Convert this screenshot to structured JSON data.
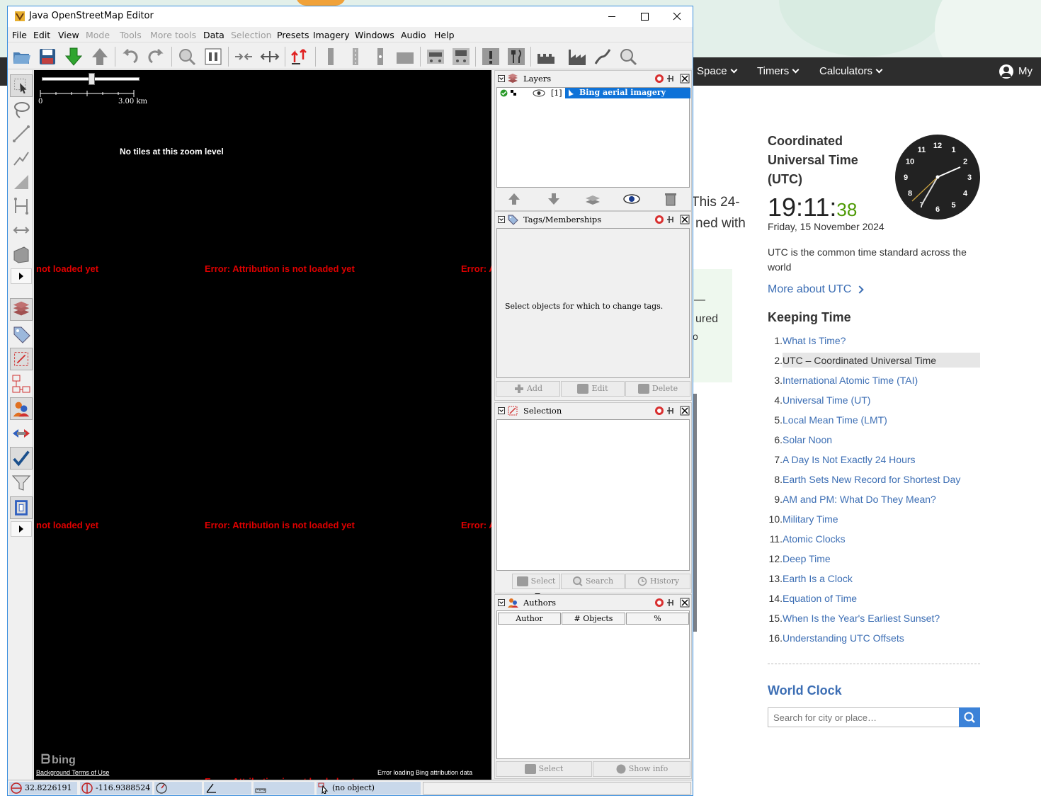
{
  "web": {
    "nav": {
      "space": "Space",
      "timers": "Timers",
      "calculators": "Calculators",
      "account": "My A"
    },
    "fragments": {
      "this24": "This 24-",
      "nedwith": "ned with",
      "ured": "ured",
      "o": "o",
      "dash": "—"
    },
    "utc": {
      "title": "Coordinated Universal Time (UTC)",
      "time_hm": "19:11:",
      "time_s": "38",
      "date": "Friday, 15 November 2024",
      "desc": "UTC is the common time standard across the world",
      "more": "More about UTC",
      "clock_numbers": [
        "12",
        "1",
        "2",
        "3",
        "4",
        "5",
        "6",
        "7",
        "8",
        "9",
        "10",
        "11"
      ]
    },
    "keeping_time": {
      "title": "Keeping Time",
      "items": [
        {
          "num": "1.",
          "label": "What Is Time?"
        },
        {
          "num": "2.",
          "label": "UTC – Coordinated Universal Time"
        },
        {
          "num": "3.",
          "label": "International Atomic Time (TAI)"
        },
        {
          "num": "4.",
          "label": "Universal Time (UT)"
        },
        {
          "num": "5.",
          "label": "Local Mean Time (LMT)"
        },
        {
          "num": "6.",
          "label": "Solar Noon"
        },
        {
          "num": "7.",
          "label": "A Day Is Not Exactly 24 Hours"
        },
        {
          "num": "8.",
          "label": "Earth Sets New Record for Shortest Day"
        },
        {
          "num": "9.",
          "label": "AM and PM: What Do They Mean?"
        },
        {
          "num": "10.",
          "label": "Military Time"
        },
        {
          "num": "11.",
          "label": "Atomic Clocks"
        },
        {
          "num": "12.",
          "label": "Deep Time"
        },
        {
          "num": "13.",
          "label": "Earth Is a Clock"
        },
        {
          "num": "14.",
          "label": "Equation of Time"
        },
        {
          "num": "15.",
          "label": "When Is the Year's Earliest Sunset?"
        },
        {
          "num": "16.",
          "label": "Understanding UTC Offsets"
        }
      ]
    },
    "world_clock": {
      "title": "World Clock",
      "placeholder": "Search for city or place…"
    }
  },
  "josm": {
    "title": "Java OpenStreetMap Editor",
    "menu": [
      "File",
      "Edit",
      "View",
      "Mode",
      "Tools",
      "More tools",
      "Data",
      "Selection",
      "Presets",
      "Imagery",
      "Windows",
      "Audio",
      "Help"
    ],
    "map": {
      "scale_start": "0",
      "scale_end": "3.00 km",
      "no_tiles": "No tiles at this zoom level",
      "err_full": "Error: Attribution is not loaded yet",
      "err_left": "not loaded yet",
      "err_right": "Error: A",
      "bing": "bing",
      "terms": "Background Terms of Use",
      "attr_error": "Error loading Bing attribution data"
    },
    "panels": {
      "layers": {
        "title": "Layers",
        "layer_index": "[1]",
        "layer_name": "Bing aerial imagery"
      },
      "tags": {
        "title": "Tags/Memberships",
        "hint": "Select objects for which to change tags.",
        "add": "Add",
        "edit": "Edit",
        "delete": "Delete"
      },
      "selection": {
        "title": "Selection",
        "select": "Select",
        "search": "Search",
        "history": "History"
      },
      "authors": {
        "title": "Authors",
        "col_author": "Author",
        "col_objects": "# Objects",
        "col_pct": "%",
        "select": "Select",
        "show_info": "Show info"
      }
    },
    "status": {
      "lat": "32.8226191",
      "lon": "-116.9388524",
      "object": "(no object)"
    }
  }
}
